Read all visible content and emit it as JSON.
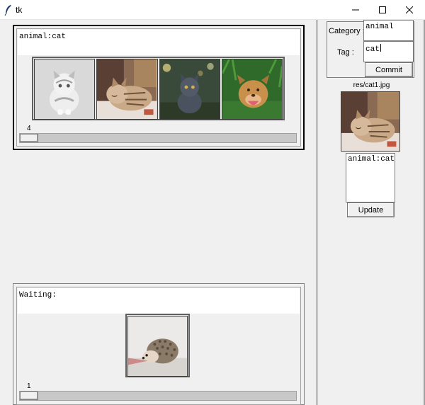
{
  "window": {
    "title": "tk",
    "app_icon": "feather-icon",
    "controls": [
      "minimize-icon",
      "maximize-icon",
      "close-icon"
    ]
  },
  "top_frame": {
    "label_text": "animal:cat",
    "thumbnails": [
      {
        "icon": "white-kitten-photo"
      },
      {
        "icon": "sleeping-tabby-cat-photo"
      },
      {
        "icon": "gray-cat-photo"
      },
      {
        "icon": "smiling-dog-photo"
      }
    ],
    "scale_value": "4"
  },
  "bottom_frame": {
    "label_text": "Waiting:",
    "thumbnails": [
      {
        "icon": "hedgehog-photo"
      }
    ],
    "scale_value": "1"
  },
  "sidebar": {
    "category_label": "Category :",
    "category_value": "animal",
    "tag_label": "Tag :",
    "tag_value": "cat",
    "commit_label": "Commit",
    "preview_filename": "res/cat1.jpg",
    "preview_icon": "sleeping-tabby-cat-photo",
    "tag_text": "animal:cat",
    "update_label": "Update"
  }
}
